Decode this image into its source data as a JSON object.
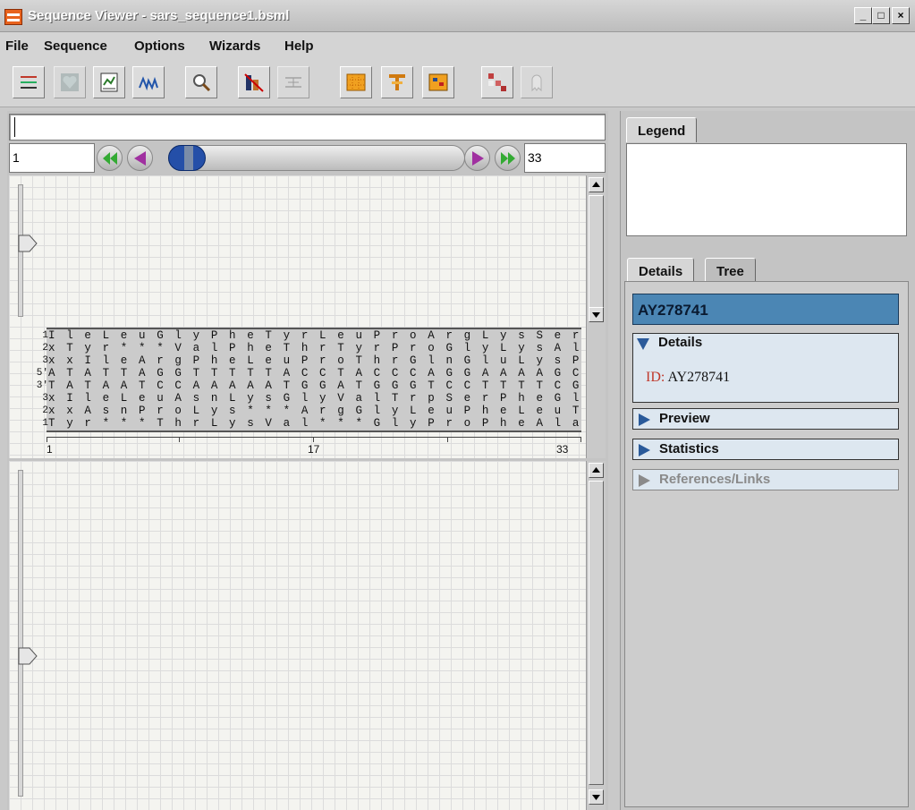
{
  "window": {
    "title": "Sequence Viewer - sars_sequence1.bsml",
    "controls": [
      "_",
      "□",
      "×"
    ]
  },
  "menu": [
    "File",
    "Sequence",
    "Options",
    "Wizards",
    "Help"
  ],
  "toolbar": {
    "buttons": [
      {
        "name": "filter-lines-icon",
        "enabled": true
      },
      {
        "name": "shape-heart-icon",
        "enabled": false
      },
      {
        "name": "document-chart-icon",
        "enabled": true
      },
      {
        "name": "peaks-icon",
        "enabled": true
      },
      {
        "name": "magnifier-icon",
        "enabled": true
      },
      {
        "name": "bar-strike-icon",
        "enabled": true
      },
      {
        "name": "align-icon",
        "enabled": false
      },
      {
        "name": "grid-orange-icon",
        "enabled": true
      },
      {
        "name": "tree-icon",
        "enabled": true
      },
      {
        "name": "matrix-icon",
        "enabled": true
      },
      {
        "name": "palette-icon",
        "enabled": true
      },
      {
        "name": "ghost-icon",
        "enabled": false
      }
    ]
  },
  "search": {
    "value": ""
  },
  "navigator": {
    "start": "1",
    "end": "33"
  },
  "sequence": {
    "rows": [
      {
        "label": "1",
        "text": "I l e L e u G l y P h e T y r L e u P r o A r g L y s S e r G l n"
      },
      {
        "label": "2",
        "text": "x T y r * * * V a l P h e T h r T y r P r o G l y L y s A l a A s"
      },
      {
        "label": "3",
        "text": "x x I l e A r g P h e L e u P r o T h r G l n G l u L y s P r o T"
      },
      {
        "label": "5'",
        "text": "A T A T T A G G T T T T T A C C T A C C C A G G A A A A G C C A A"
      },
      {
        "label": "3'",
        "text": "T A T A A T C C A A A A A T G G A T G G G T C C T T T T C G G T T"
      },
      {
        "label": "3",
        "text": "x I l e L e u A s n L y s G l y V a l T r p S e r P h e G l y V a"
      },
      {
        "label": "2",
        "text": "x x A s n P r o L y s * * * A r g G l y L e u P h e L e u T r p G"
      },
      {
        "label": "1",
        "text": "T y r * * * T h r L y s V a l * * * G l y P r o P h e A l a L e u"
      }
    ],
    "ruler": {
      "start": "1",
      "mid": "17",
      "end": "33"
    }
  },
  "right": {
    "legend_tab": "Legend",
    "tabs": [
      "Details",
      "Tree"
    ],
    "accession": "AY278741",
    "sections": {
      "details": "Details",
      "id_key": "ID:",
      "id_value": "AY278741",
      "preview": "Preview",
      "statistics": "Statistics",
      "references": "References/Links"
    }
  }
}
